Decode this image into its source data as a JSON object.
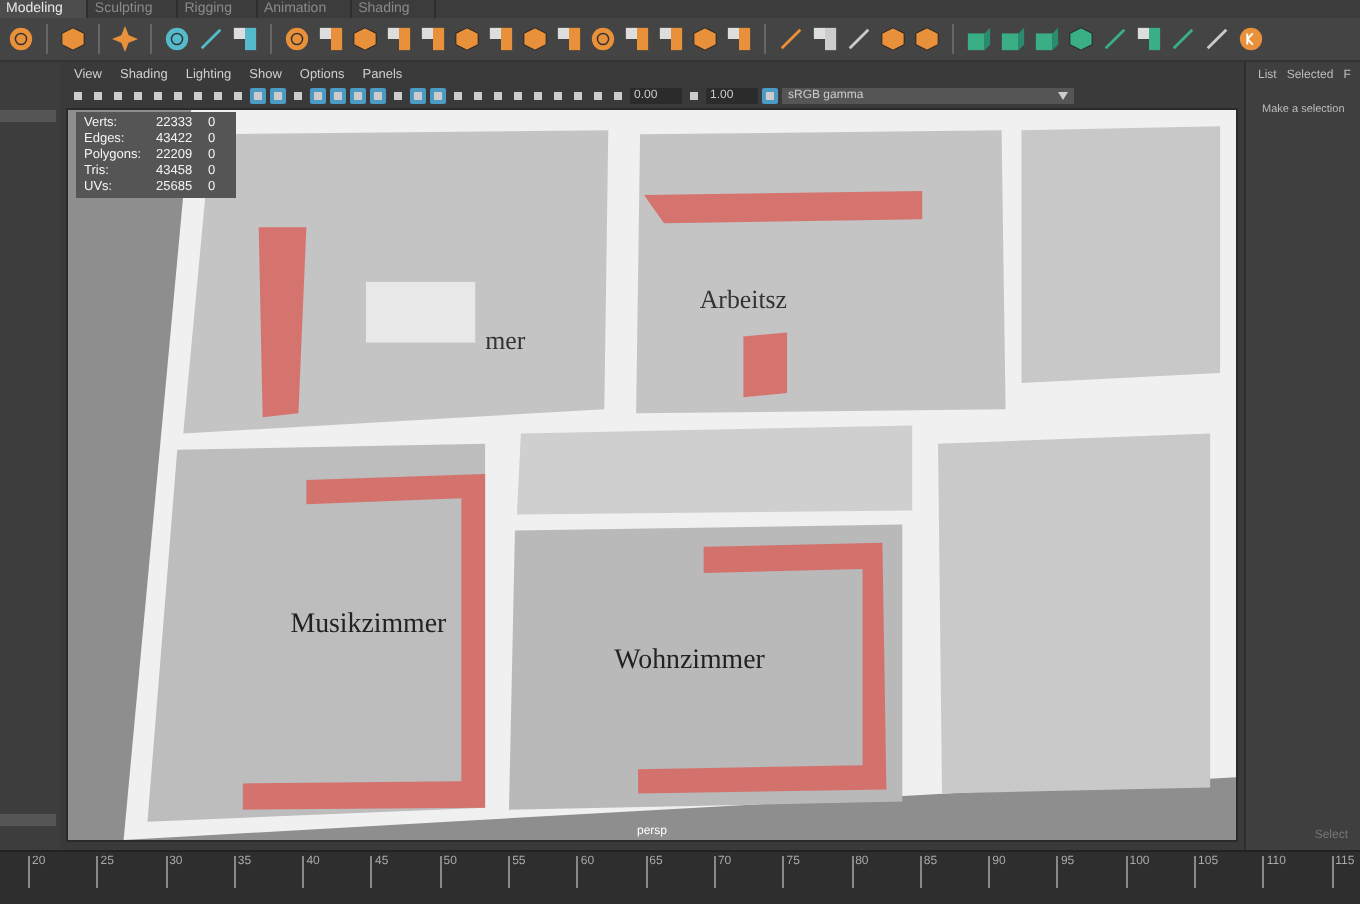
{
  "shelf_tabs": [
    {
      "label": "Modeling",
      "selected": true
    },
    {
      "label": "Sculpting",
      "selected": false
    },
    {
      "label": "Rigging",
      "selected": false
    },
    {
      "label": "Animation",
      "selected": false
    },
    {
      "label": "Shading",
      "selected": false
    }
  ],
  "viewport_menu": [
    "View",
    "Shading",
    "Lighting",
    "Show",
    "Options",
    "Panels"
  ],
  "viewport_toolbar": {
    "exposure": "0.00",
    "gamma": "1.00",
    "color_space": "sRGB gamma"
  },
  "hud": [
    {
      "label": "Verts:",
      "value": "22333",
      "selected_value": "0"
    },
    {
      "label": "Edges:",
      "value": "43422",
      "selected_value": "0"
    },
    {
      "label": "Polygons:",
      "value": "22209",
      "selected_value": "0"
    },
    {
      "label": "Tris:",
      "value": "43458",
      "selected_value": "0"
    },
    {
      "label": "UVs:",
      "value": "25685",
      "selected_value": "0"
    }
  ],
  "room_labels": [
    {
      "text": "mer"
    },
    {
      "text": "Arbeitsz"
    },
    {
      "text": "Musikzimmer"
    },
    {
      "text": "Wohnzimmer"
    }
  ],
  "camera_label": "persp",
  "right_panel": {
    "menu": [
      "List",
      "Selected",
      "F"
    ],
    "message": "Make a selection",
    "footer": "Select"
  },
  "timeline": {
    "ticks": [
      "20",
      "25",
      "30",
      "35",
      "40",
      "45",
      "50",
      "55",
      "60",
      "65",
      "70",
      "75",
      "80",
      "85",
      "90",
      "95",
      "100",
      "105",
      "110",
      "115"
    ]
  }
}
